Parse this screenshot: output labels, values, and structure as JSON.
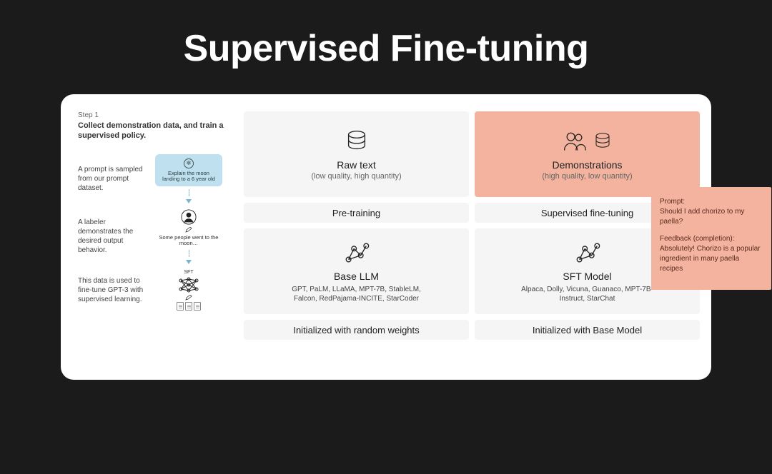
{
  "title": "Supervised Fine-tuning",
  "step": {
    "label": "Step 1",
    "heading": "Collect demonstration data, and train a supervised policy.",
    "rows": [
      {
        "text": "A prompt is sampled from our prompt dataset.",
        "chip": "Explain the moon landing to a 6 year old"
      },
      {
        "text": "A labeler demonstrates the desired output behavior.",
        "caption": "Some people went to the moon…"
      },
      {
        "text": "This data is used to fine-tune GPT-3 with supervised learning.",
        "sft_label": "SFT"
      }
    ]
  },
  "grid": {
    "raw": {
      "title": "Raw text",
      "sub": "(low quality, high quantity)"
    },
    "demo": {
      "title": "Demonstrations",
      "sub": "(high quality, low quantity)"
    },
    "pre": "Pre-training",
    "sft": "Supervised fine-tuning",
    "base": {
      "title": "Base LLM",
      "list": "GPT, PaLM, LLaMA, MPT-7B, StableLM, Falcon, RedPajama-INCITE, StarCoder"
    },
    "sftm": {
      "title": "SFT Model",
      "list": "Alpaca, Dolly, Vicuna, Guanaco, MPT-7B-Instruct, StarChat"
    },
    "init_l": "Initialized with random weights",
    "init_r": "Initialized with Base Model"
  },
  "note": {
    "prompt_label": "Prompt:",
    "prompt_body": "Should I add chorizo to my paella?",
    "feedback_label": "Feedback (completion):",
    "feedback_body": "Absolutely! Chorizo is a popular ingredient in many paella recipes"
  }
}
